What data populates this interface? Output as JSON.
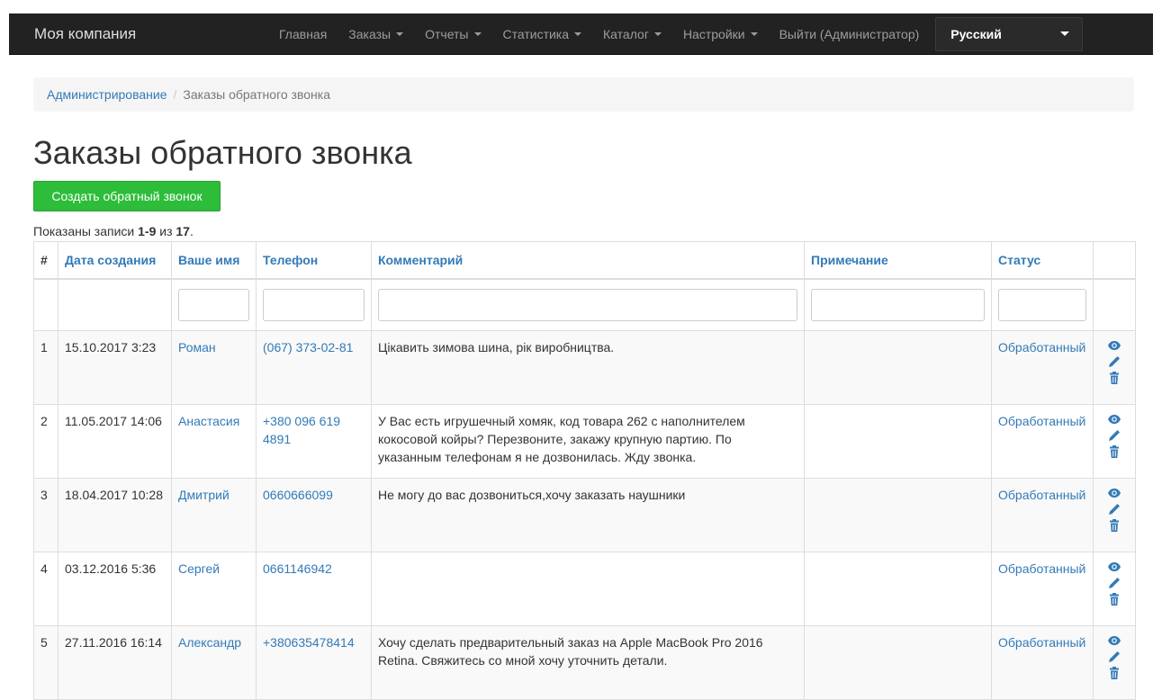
{
  "navbar": {
    "brand": "Моя компания",
    "items": [
      {
        "label": "Главная",
        "dropdown": false
      },
      {
        "label": "Заказы",
        "dropdown": true
      },
      {
        "label": "Отчеты",
        "dropdown": true
      },
      {
        "label": "Статистика",
        "dropdown": true
      },
      {
        "label": "Каталог",
        "dropdown": true
      },
      {
        "label": "Настройки",
        "dropdown": true
      },
      {
        "label": "Выйти (Администратор)",
        "dropdown": false
      }
    ],
    "language": "Русский"
  },
  "breadcrumb": {
    "root": "Администрирование",
    "current": "Заказы обратного звонка"
  },
  "page_title": "Заказы обратного звонка",
  "create_button": "Создать обратный звонок",
  "summary": {
    "prefix": "Показаны записи ",
    "range": "1-9",
    "middle": " из ",
    "total": "17",
    "suffix": "."
  },
  "table": {
    "columns": [
      "#",
      "Дата создания",
      "Ваше имя",
      "Телефон",
      "Комментарий",
      "Примечание",
      "Статус"
    ],
    "rows": [
      {
        "num": "1",
        "date": "15.10.2017 3:23",
        "name": "Роман",
        "phone": "(067) 373-02-81",
        "comment": "Цікавить зимова шина, рік виробництва.",
        "note": "",
        "status": "Обработанный"
      },
      {
        "num": "2",
        "date": "11.05.2017 14:06",
        "name": "Анастасия",
        "phone": "+380 096 619 4891",
        "comment": "У Вас есть игрушечный хомяк, код товара 262 с наполнителем кокосовой койры? Перезвоните, закажу крупную партию. По указанным телефонам я не дозвонилась. Жду звонка.",
        "note": "",
        "status": "Обработанный"
      },
      {
        "num": "3",
        "date": "18.04.2017 10:28",
        "name": "Дмитрий",
        "phone": "0660666099",
        "comment": "Не могу до вас дозвониться,хочу заказать наушники",
        "note": "",
        "status": "Обработанный"
      },
      {
        "num": "4",
        "date": "03.12.2016 5:36",
        "name": "Сергей",
        "phone": "0661146942",
        "comment": "",
        "note": "",
        "status": "Обработанный"
      },
      {
        "num": "5",
        "date": "27.11.2016 16:14",
        "name": "Александр",
        "phone": "+380635478414",
        "comment": "Хочу сделать предварительный заказ на Apple MacBook Pro 2016 Retina. Свяжитесь со мной хочу уточнить детали.",
        "note": "",
        "status": "Обработанный"
      }
    ]
  },
  "icons": {
    "view": "eye-icon",
    "edit": "pencil-icon",
    "delete": "trash-icon"
  },
  "colors": {
    "link": "#337ab7",
    "navbar": "#222222",
    "create_button": "#2dbd3a"
  }
}
